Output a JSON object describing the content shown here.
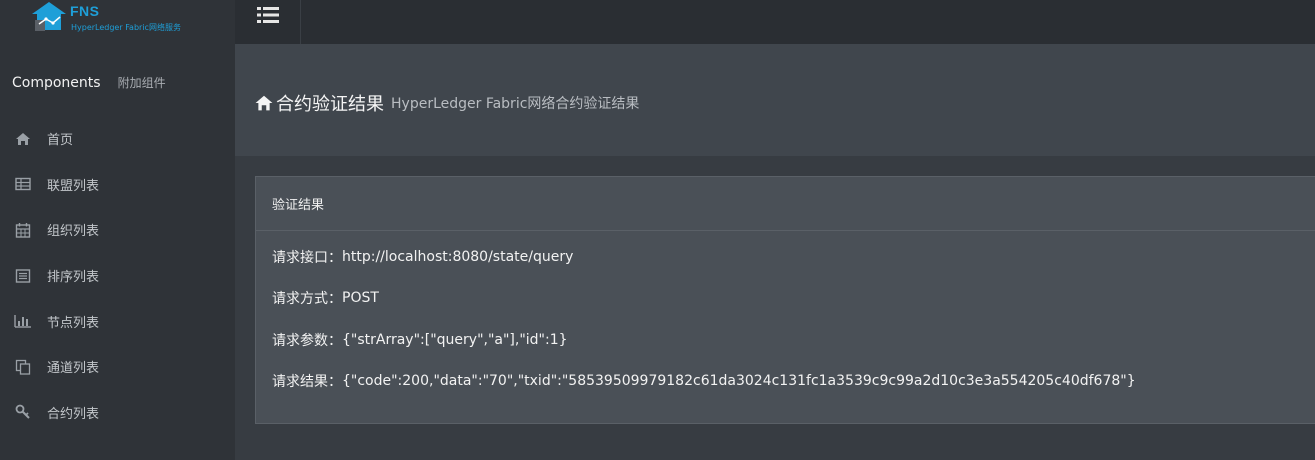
{
  "logo": {
    "name": "FNS",
    "subtitle": "HyperLedger Fabric网络服务"
  },
  "sidebar": {
    "section_title": "Components",
    "section_subtitle": "附加组件",
    "items": [
      {
        "label": "首页",
        "icon": "home-icon"
      },
      {
        "label": "联盟列表",
        "icon": "table-icon"
      },
      {
        "label": "组织列表",
        "icon": "calendar-icon"
      },
      {
        "label": "排序列表",
        "icon": "list-alt-icon"
      },
      {
        "label": "节点列表",
        "icon": "bar-chart-icon"
      },
      {
        "label": "通道列表",
        "icon": "copy-icon"
      },
      {
        "label": "合约列表",
        "icon": "key-icon"
      }
    ]
  },
  "header": {
    "title": "合约验证结果",
    "subtitle": "HyperLedger Fabric网络合约验证结果"
  },
  "panel": {
    "title": "验证结果",
    "rows": [
      {
        "label": "请求接口：",
        "value": "http://localhost:8080/state/query"
      },
      {
        "label": "请求方式：",
        "value": "POST"
      },
      {
        "label": "请求参数：",
        "value": "{\"strArray\":[\"query\",\"a\"],\"id\":1}"
      },
      {
        "label": "请求结果：",
        "value": "{\"code\":200,\"data\":\"70\",\"txid\":\"58539509979182c61da3024c131fc1a3539c9c99a2d10c3e3a554205c40df678\"}"
      }
    ]
  },
  "colors": {
    "accent": "#1e9fd8",
    "sidebar_bg": "#2f3338",
    "header_bg": "#40464d",
    "panel_bg": "#4a5057"
  }
}
